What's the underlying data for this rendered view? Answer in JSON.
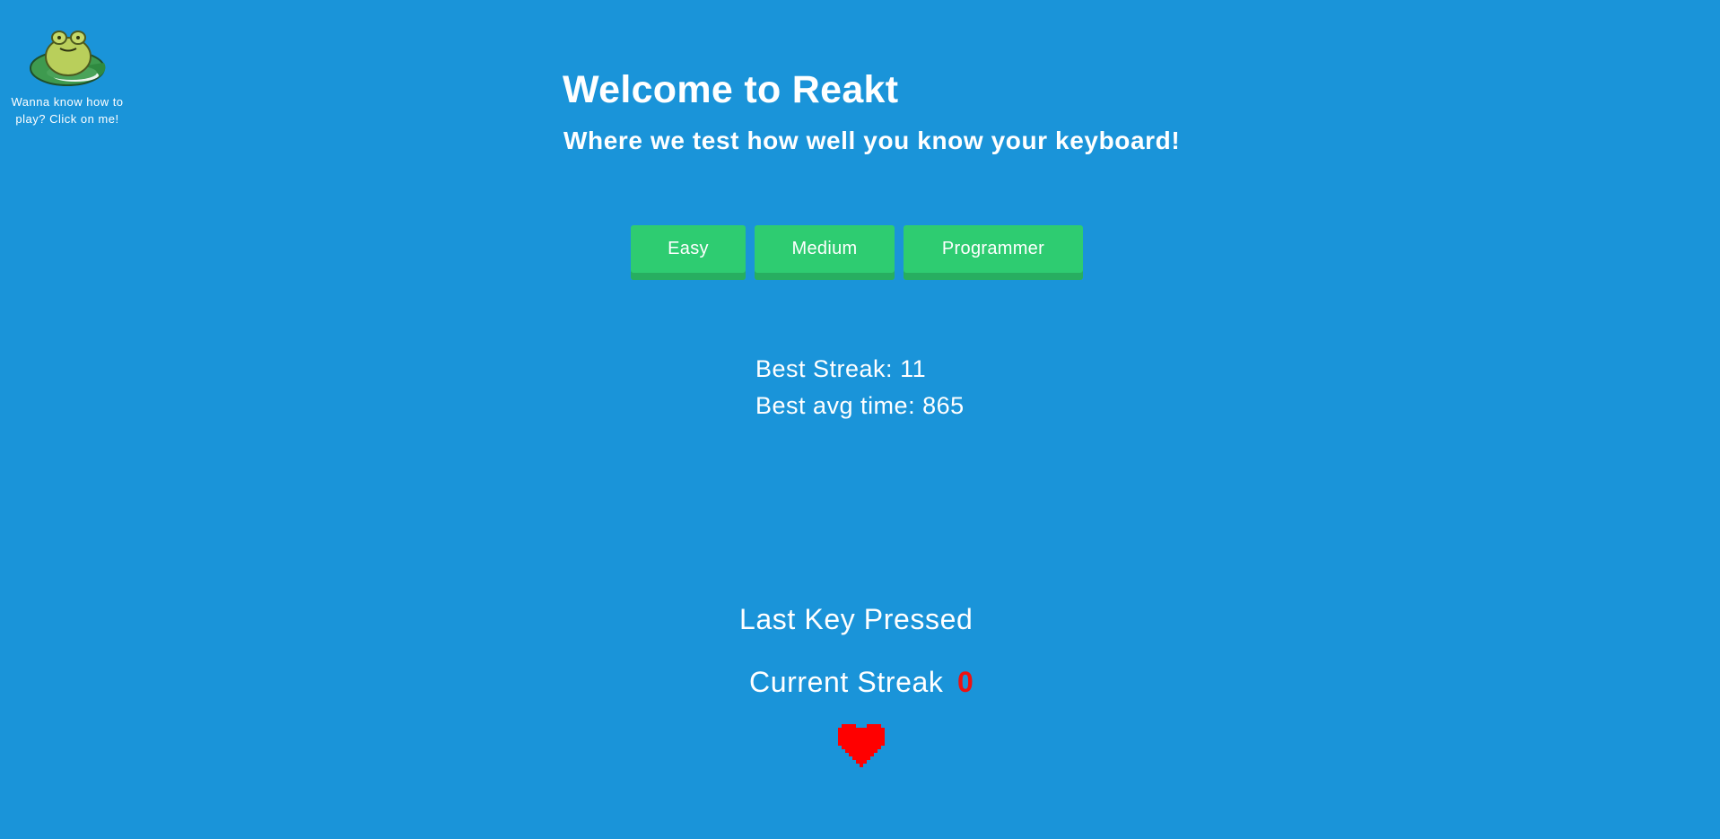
{
  "help": {
    "text": "Wanna know how to play? Click on me!",
    "icon": "frog-on-lilypad-icon"
  },
  "header": {
    "title": "Welcome to Reakt",
    "subtitle": "Where we test how well you know your keyboard!"
  },
  "difficulty": {
    "buttons": [
      {
        "label": "Easy"
      },
      {
        "label": "Medium"
      },
      {
        "label": "Programmer"
      }
    ],
    "button_color": "#2ecc71"
  },
  "stats": {
    "best_streak": "Best Streak: 11",
    "best_avg_time": "Best avg time: 865"
  },
  "game": {
    "last_key_label": "Last Key Pressed",
    "current_streak_label": "Current Streak",
    "current_streak_value": "0",
    "lives_icon": "heart-icon",
    "lives_color": "#ff0000"
  },
  "colors": {
    "background": "#1a94d9",
    "text": "#ffffff",
    "streak_value": "#ee1111"
  }
}
